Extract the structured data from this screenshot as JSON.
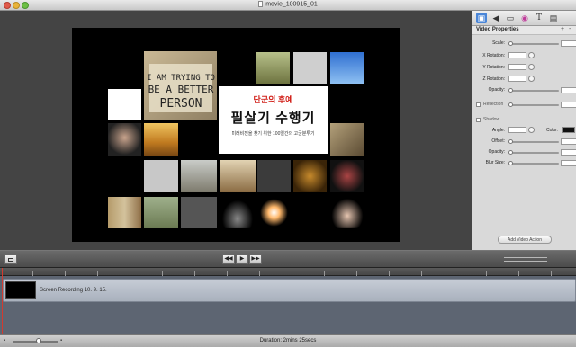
{
  "window": {
    "title": "movie_100915_01"
  },
  "stage": {
    "title_card": {
      "line1": "단군의 후예",
      "line2": "필살기 수행기",
      "line3": "미래비전을 찾기 위한 100일간의 고군분투기"
    },
    "photo_sign_lines": [
      "I AM TRYING TO",
      "BE A BETTER",
      "PERSON"
    ]
  },
  "inspector": {
    "tab_icons": [
      "film-icon",
      "speaker-icon",
      "screen-icon",
      "target-icon",
      "text-icon",
      "clipboard-icon"
    ],
    "header": {
      "label": "Video Properties",
      "plus": "+",
      "minus": "-"
    },
    "rows": {
      "scale": "Scale:",
      "x_rotation": "X Rotation:",
      "y_rotation": "Y Rotation:",
      "z_rotation": "Z Rotation:",
      "opacity": "Opacity:",
      "reflection": "Reflection",
      "shadow": "Shadow",
      "angle": "Angle:",
      "color": "Color:",
      "offset": "Offset:",
      "shadow_opacity": "Opacity:",
      "blur_size": "Blur Size:"
    },
    "add_button": "Add Video Action"
  },
  "transport": {
    "rewind": "◀◀",
    "play": "▶",
    "forward": "▶▶"
  },
  "timeline": {
    "clip_label": "Screen Recording 10. 9. 15."
  },
  "status": {
    "duration": "Duration: 2mins 25secs"
  },
  "colors": {
    "accent": "#4a86d8",
    "title_red": "#d2231c",
    "playhead": "#d23b2f"
  }
}
